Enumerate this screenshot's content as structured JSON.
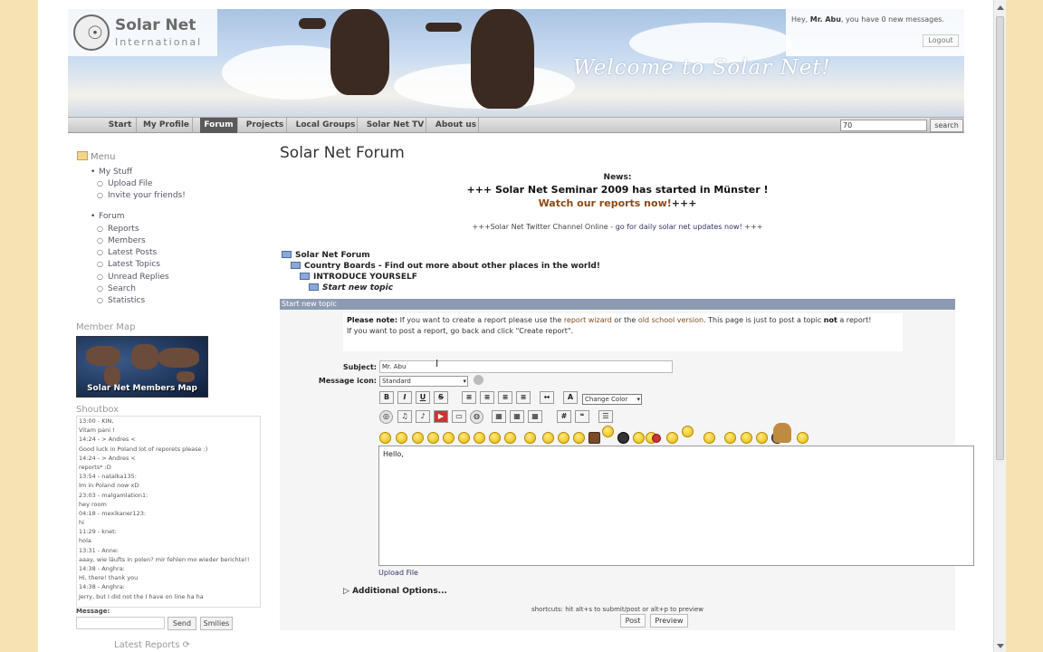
{
  "header": {
    "logo_title": "Solar Net",
    "logo_sub": "International",
    "welcome": "Welcome to Solar Net!",
    "greeting_prefix": "Hey, ",
    "user_name": "Mr. Abu",
    "greeting_suffix": ", you have 0 new messages.",
    "logout_label": "Logout"
  },
  "nav": {
    "items": [
      "Start",
      "My Profile",
      "Forum",
      "Projects",
      "Local Groups",
      "Solar Net TV",
      "About us"
    ],
    "active": "Forum",
    "search_value": "70",
    "search_button": "search"
  },
  "sidebar": {
    "menu_title": "Menu",
    "my_stuff": "My Stuff",
    "my_stuff_items": [
      "Upload File",
      "Invite your friends!"
    ],
    "forum": "Forum",
    "forum_items": [
      "Reports",
      "Members",
      "Latest Posts",
      "Latest Topics",
      "Unread Replies",
      "Search",
      "Statistics"
    ],
    "member_map_title": "Member Map",
    "member_map_label": "Solar Net Members Map",
    "shoutbox_title": "Shoutbox",
    "shouts": [
      "13:00 - KIN,",
      "Vitam pani !",
      "14:24 - > Andres <",
      "Good luck in Poland       lot of reporets please :)",
      "14:24 - > Andres <",
      "reports* :D",
      "13:54 - natalka135:",
      "Im in Poland now xD",
      "23:03 - malgamlation1:",
      "hey room",
      "04:18 - mexikaner123:",
      "hi",
      "11:29 - knet:",
      "hola",
      "13:31 - Anne:",
      "aaay, wie läufts in polen? mir fehlen mo wieder berichte!!",
      "14:38 - Anghra:",
      "Hi, there! thank you",
      "14:38 - Anghra:",
      "Jerry, but I did not the I have on line ha ha"
    ],
    "message_label": "Message:",
    "send_label": "Send",
    "smilies_label": "Smilies",
    "latest_reports": "Latest Reports"
  },
  "main": {
    "title": "Solar Net Forum",
    "news_label": "News:",
    "news_headline": "+++ Solar Net Seminar 2009 has started in Münster !",
    "news_link": "Watch our reports now!",
    "news_link_suffix": "+++",
    "twitter_prefix": "+++Solar Net Twitter Channel Online - ",
    "twitter_link": "go for daily solar net updates now!",
    "twitter_suffix": " +++",
    "breadcrumb": [
      "Solar Net Forum",
      "Country Boards - Find out more about other places in the world!",
      "INTRODUCE YOURSELF",
      "Start new topic"
    ],
    "bar_label": "Start new topic",
    "note_bold": "Please note:",
    "note_text1": " If you want to create a report please use the ",
    "note_link1": "report wizard",
    "note_text2": " or the ",
    "note_link2": "old school version",
    "note_text3": ". This page is just to post a topic ",
    "note_not": "not",
    "note_text4": " a report!",
    "note_line2": "If you want to post a report, go back and click \"Create report\".",
    "subject_label": "Subject:",
    "subject_value": "Mr. Abu",
    "message_icon_label": "Message icon:",
    "message_icon_value": "Standard",
    "change_color": "Change Color",
    "message_body": "Hello,",
    "upload_file": "Upload File",
    "additional_options": "Additional Options...",
    "shortcuts": "shortcuts: hit alt+s to submit/post or alt+p to preview",
    "post_label": "Post",
    "preview_label": "Preview"
  },
  "colors": {
    "accent_link": "#8a4a18",
    "bar": "#8d9bb2",
    "nav_active": "#5a5a5a",
    "page_background": "#f6e3b3"
  }
}
